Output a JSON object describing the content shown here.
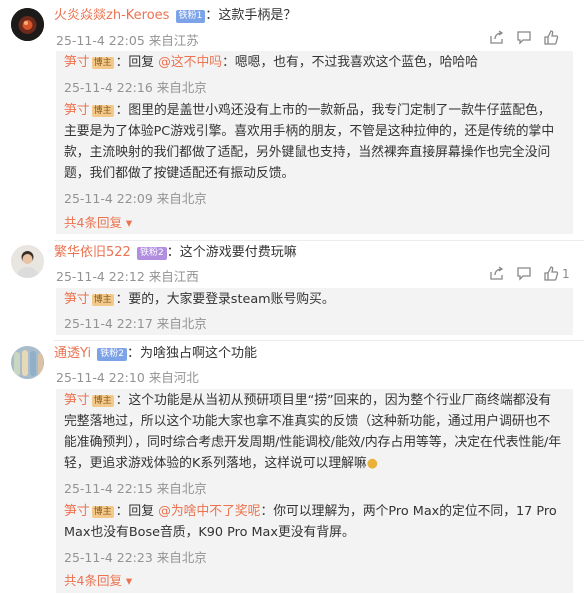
{
  "colors": {
    "accent": "#eb7350",
    "meta": "#939393",
    "reply_bg": "#f3f3f3"
  },
  "threads": [
    {
      "user": "火炎焱燚zh-Keroes",
      "badge": "铁粉1",
      "colon": "：",
      "text": "这款手柄是？",
      "meta": "25-11-4 22:05 来自江苏",
      "like_count": "",
      "replies": [
        {
          "user": "笋寸",
          "badge": "博主",
          "prefix": "：回复 ",
          "at": "@这不中吗",
          "text": "：嗯嗯，也有，不过我喜欢这个蓝色，哈哈哈",
          "meta": "25-11-4 22:16 来自北京"
        },
        {
          "user": "笋寸",
          "badge": "博主",
          "prefix": "",
          "at": "",
          "text": "：图里的是盖世小鸡还没有上市的一款新品，我专门定制了一款牛仔蓝配色，主要是为了体验PC游戏引擎。喜欢用手柄的朋友，不管是这种拉伸的，还是传统的掌中款，主流映射的我们都做了适配，另外键鼠也支持，当然裸奔直接屏幕操作也完全没问题，我们都做了按键适配还有振动反馈。",
          "meta": "25-11-4 22:09 来自北京"
        }
      ],
      "more": "共4条回复"
    },
    {
      "user": "繁华依旧522",
      "badge": "铁粉2",
      "colon": "：",
      "text": "这个游戏要付费玩嘛",
      "meta": "25-11-4 22:12 来自江西",
      "like_count": "1",
      "replies": [
        {
          "user": "笋寸",
          "badge": "博主",
          "prefix": "",
          "at": "",
          "text": "：要的，大家要登录steam账号购买。",
          "meta": "25-11-4 22:17 来自北京"
        }
      ],
      "more": ""
    },
    {
      "user": "通透Yi",
      "badge": "铁粉2",
      "colon": "：",
      "text": "为啥独占啊这个功能",
      "meta": "25-11-4 22:10 来自河北",
      "like_count": "",
      "replies": [
        {
          "user": "笋寸",
          "badge": "博主",
          "prefix": "",
          "at": "",
          "text": "：这个功能是从当初从预研项目里“捞”回来的，因为整个行业厂商终端都没有完整落地过，所以这个功能大家也拿不准真实的反馈（这种新功能，通过用户调研也不能准确预判），同时综合考虑开发周期/性能调校/能效/内存占用等等，决定在代表性能/年轻，更追求游戏体验的K系列落地，这样说可以理解嘛",
          "meta": "25-11-4 22:15 来自北京"
        },
        {
          "user": "笋寸",
          "badge": "博主",
          "prefix": "：回复 ",
          "at": "@为啥中不了奖呢",
          "text": "：你可以理解为，两个Pro Max的定位不同，17 Pro Max也没有Bose音质，K90 Pro Max更没有背屏。",
          "meta": "25-11-4 22:23 来自北京"
        }
      ],
      "more": "共4条回复"
    }
  ]
}
